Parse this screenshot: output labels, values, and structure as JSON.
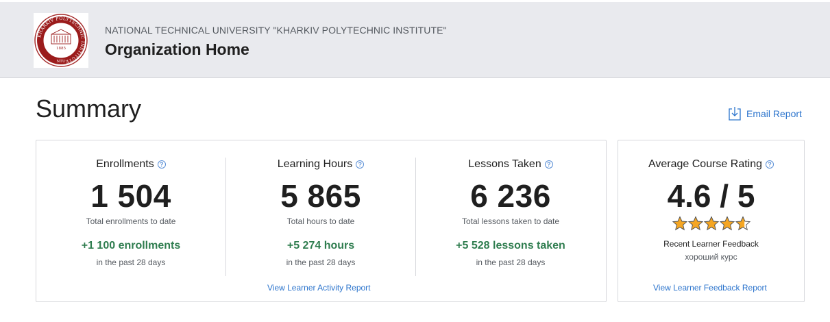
{
  "header": {
    "org_name": "NATIONAL TECHNICAL UNIVERSITY \"KHARKIV POLYTECHNIC INSTITUTE\"",
    "page_title": "Organization Home",
    "logo": {
      "icon": "university-seal-logo",
      "ring_text": "KHARKIV POLYTECHNIC INSTITUTE",
      "year": "1885",
      "abbr": "NTU"
    }
  },
  "summary": {
    "title": "Summary",
    "email_report_label": "Email Report",
    "email_icon": "download-icon",
    "accent_color": "#2a73cc",
    "positive_color": "#2f7d4f"
  },
  "stats": [
    {
      "label": "Enrollments",
      "value": "1 504",
      "sub": "Total enrollments to date",
      "delta": "+1 100 enrollments",
      "period": "in the past 28 days"
    },
    {
      "label": "Learning Hours",
      "value": "5 865",
      "sub": "Total hours to date",
      "delta": "+5 274 hours",
      "period": "in the past 28 days"
    },
    {
      "label": "Lessons Taken",
      "value": "6 236",
      "sub": "Total lessons taken to date",
      "delta": "+5 528 lessons taken",
      "period": "in the past 28 days"
    }
  ],
  "activity_report_link": "View Learner Activity Report",
  "rating": {
    "label": "Average Course Rating",
    "value": "4.6 / 5",
    "stars": 4.6,
    "star_color": "#f5a623",
    "feedback_title": "Recent Learner Feedback",
    "feedback_text": "хороший курс",
    "report_link": "View Learner Feedback Report"
  },
  "help_icon_glyph": "?"
}
